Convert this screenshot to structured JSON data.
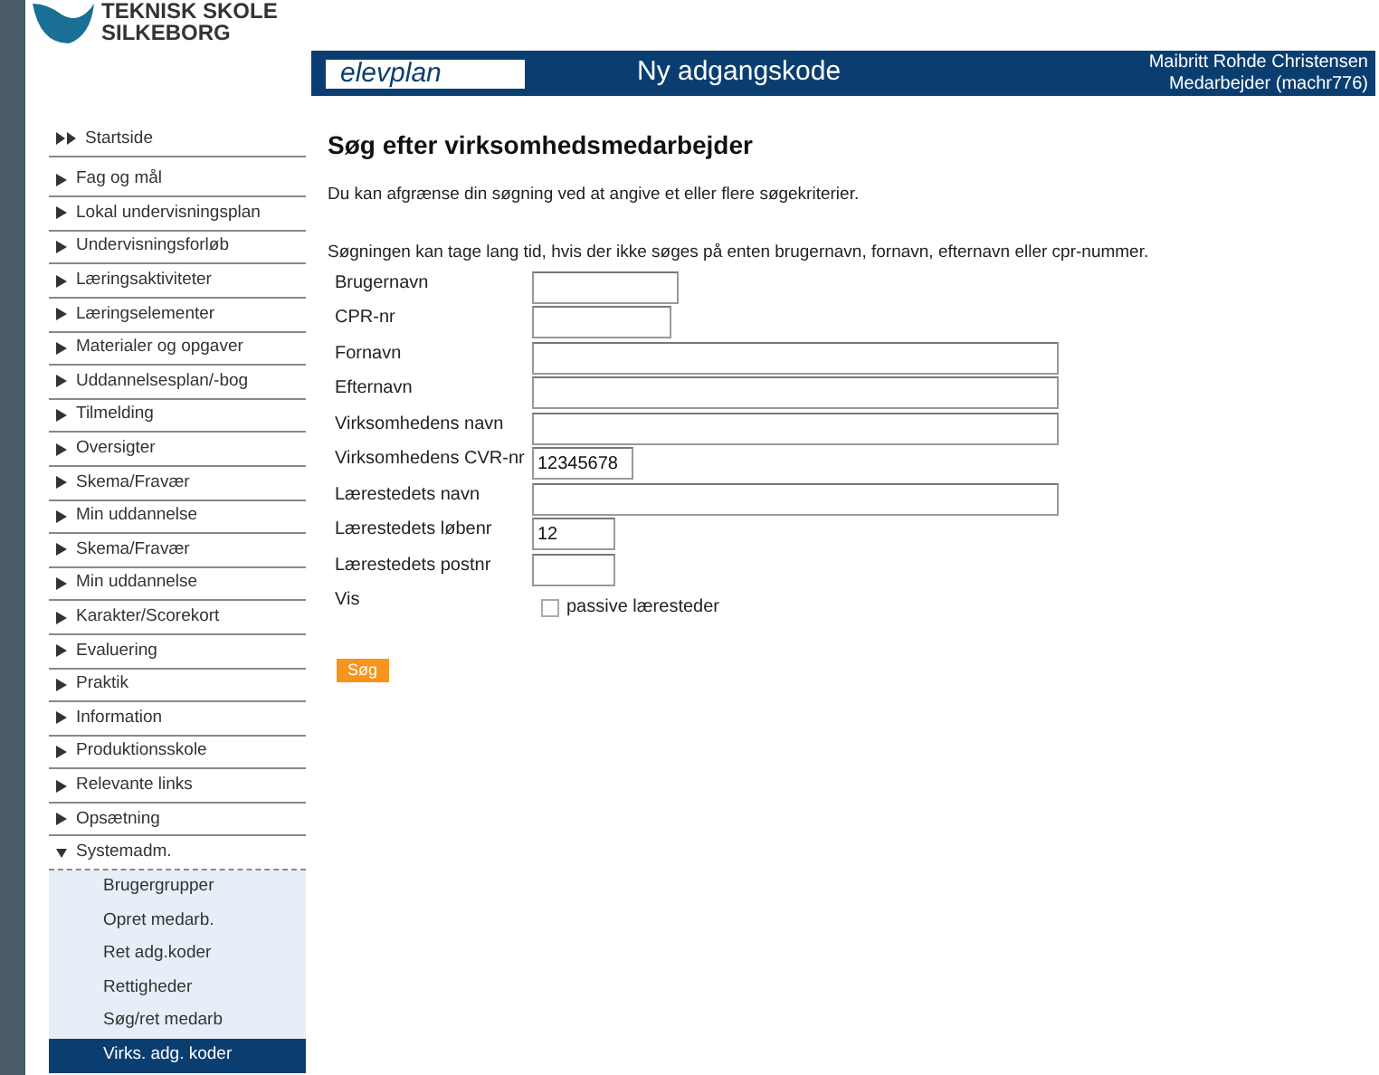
{
  "logo": {
    "line_1": "TEKNISK SKOLE",
    "line_2": "SILKEBORG"
  },
  "header": {
    "brand": "elevplan",
    "title": "Ny adgangskode",
    "user_name": "Maibritt Rohde Christensen",
    "user_role": "Medarbejder (machr776)"
  },
  "sidebar": {
    "items": [
      {
        "label": "Startside",
        "kind": "home"
      },
      {
        "label": "Fag og mål",
        "kind": "section",
        "expanded": false
      },
      {
        "label": "Lokal undervisningsplan",
        "kind": "section",
        "expanded": false
      },
      {
        "label": "Undervisningsforløb",
        "kind": "section",
        "expanded": false
      },
      {
        "label": "Læringsaktiviteter",
        "kind": "section",
        "expanded": false
      },
      {
        "label": "Læringselementer",
        "kind": "section",
        "expanded": false
      },
      {
        "label": "Materialer og opgaver",
        "kind": "section",
        "expanded": false
      },
      {
        "label": "Uddannelsesplan/-bog",
        "kind": "section",
        "expanded": false
      },
      {
        "label": "Tilmelding",
        "kind": "section",
        "expanded": false
      },
      {
        "label": "Oversigter",
        "kind": "section",
        "expanded": false
      },
      {
        "label": "Skema/Fravær",
        "kind": "section",
        "expanded": false
      },
      {
        "label": "Min uddannelse",
        "kind": "section",
        "expanded": false
      },
      {
        "label": "Skema/Fravær",
        "kind": "section",
        "expanded": false
      },
      {
        "label": "Min uddannelse",
        "kind": "section",
        "expanded": false
      },
      {
        "label": "Karakter/Scorekort",
        "kind": "section",
        "expanded": false
      },
      {
        "label": "Evaluering",
        "kind": "section",
        "expanded": false
      },
      {
        "label": "Praktik",
        "kind": "section",
        "expanded": false
      },
      {
        "label": "Information",
        "kind": "section",
        "expanded": false
      },
      {
        "label": "Produktionsskole",
        "kind": "section",
        "expanded": false
      },
      {
        "label": "Relevante links",
        "kind": "section",
        "expanded": false
      },
      {
        "label": "Opsætning",
        "kind": "section",
        "expanded": false
      },
      {
        "label": "Systemadm.",
        "kind": "section",
        "expanded": true,
        "children": [
          {
            "label": "Brugergrupper",
            "selected": false
          },
          {
            "label": "Opret medarb.",
            "selected": false
          },
          {
            "label": "Ret adg.koder",
            "selected": false
          },
          {
            "label": "Rettigheder",
            "selected": false
          },
          {
            "label": "Søg/ret medarb",
            "selected": false
          },
          {
            "label": "Virks. adg. koder",
            "selected": true
          }
        ]
      }
    ]
  },
  "main": {
    "heading": "Søg efter virksomhedsmedarbejder",
    "intro": "Du kan afgrænse din søgning ved at angive et eller flere søgekriterier.",
    "note": "Søgningen kan tage lang tid, hvis der ikke søges på enten brugernavn, fornavn, efternavn eller cpr-nummer.",
    "fields": [
      {
        "label": "Brugernavn",
        "kind": "text"
      },
      {
        "label": "CPR-nr",
        "kind": "text"
      },
      {
        "label": "Fornavn",
        "kind": "text"
      },
      {
        "label": "Efternavn",
        "kind": "text"
      },
      {
        "label": "Virksomhedens navn",
        "kind": "text"
      },
      {
        "label": "Virksomhedens CVR-nr",
        "kind": "text",
        "value": "12345678"
      },
      {
        "label": "Lærestedets navn",
        "kind": "text"
      },
      {
        "label": "Lærestedets løbenr",
        "kind": "text",
        "value": "12"
      },
      {
        "label": "Lærestedets postnr",
        "kind": "text"
      },
      {
        "label": "Vis",
        "kind": "checkbox",
        "option": "passive læresteder",
        "checked": false
      }
    ],
    "button": "Søg"
  }
}
